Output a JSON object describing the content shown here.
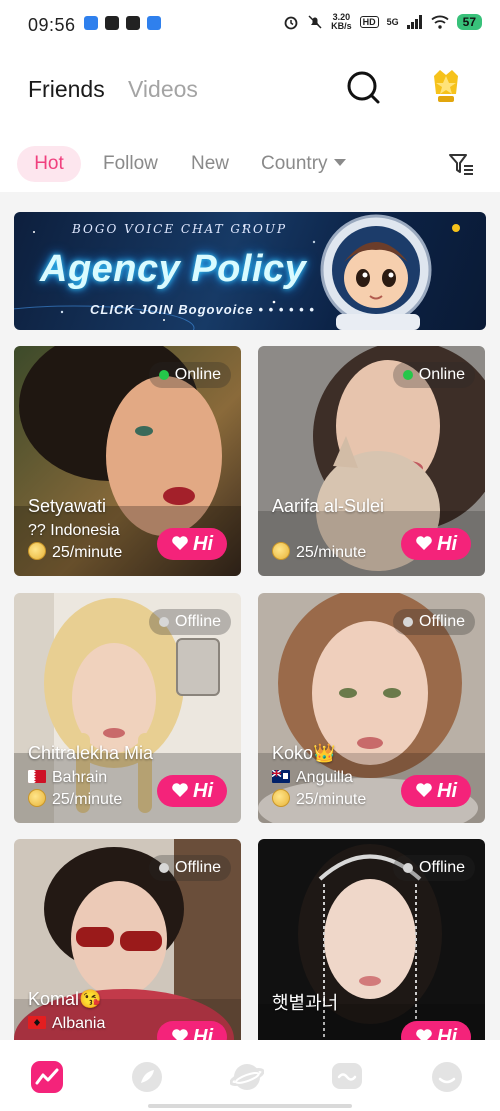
{
  "status_bar": {
    "time": "09:56",
    "network_speed_value": "3.20",
    "network_speed_unit": "KB/s",
    "hd_label": "HD",
    "signal_label": "5G",
    "battery": "57"
  },
  "header": {
    "tabs": [
      {
        "label": "Friends",
        "active": true
      },
      {
        "label": "Videos",
        "active": false
      }
    ]
  },
  "filters": {
    "items": [
      {
        "label": "Hot",
        "active": true
      },
      {
        "label": "Follow",
        "active": false
      },
      {
        "label": "New",
        "active": false
      },
      {
        "label": "Country",
        "active": false,
        "has_dropdown": true
      }
    ]
  },
  "banner": {
    "top_text": "BOGO VOICE CHAT GROUP",
    "title": "Agency Policy",
    "cta": "CLICK JOIN Bogovoice",
    "dots": "• • • • • •"
  },
  "cards": [
    {
      "name": "Setyawati",
      "country": "?? Indonesia",
      "rate": "25/minute",
      "status": "Online",
      "hi_label": "Hi",
      "flag": "none"
    },
    {
      "name": "Aarifa al-Sulei",
      "country": "",
      "rate": "25/minute",
      "status": "Online",
      "hi_label": "Hi",
      "flag": "none"
    },
    {
      "name": "Chitralekha Mia",
      "country": "Bahrain",
      "rate": "25/minute",
      "status": "Offline",
      "hi_label": "Hi",
      "flag": "bahrain"
    },
    {
      "name": "Koko👑",
      "country": "Anguilla",
      "rate": "25/minute",
      "status": "Offline",
      "hi_label": "Hi",
      "flag": "anguilla"
    },
    {
      "name": "Komal😘",
      "country": "Albania",
      "rate": "",
      "status": "Offline",
      "hi_label": "Hi",
      "flag": "albania"
    },
    {
      "name": "햇볕과너",
      "country": "",
      "rate": "",
      "status": "Offline",
      "hi_label": "Hi",
      "flag": "none"
    }
  ],
  "colors": {
    "accent": "#f4237a",
    "hot_tab_bg": "#fde6ee",
    "hot_tab_text": "#f0407e",
    "online": "#25c74a",
    "offline": "#d7d7d7"
  },
  "bottom_nav": {
    "items": [
      {
        "icon": "trending-icon",
        "active": true
      },
      {
        "icon": "feather-icon",
        "active": false
      },
      {
        "icon": "planet-icon",
        "active": false
      },
      {
        "icon": "chat-icon",
        "active": false
      },
      {
        "icon": "profile-icon",
        "active": false
      }
    ]
  }
}
